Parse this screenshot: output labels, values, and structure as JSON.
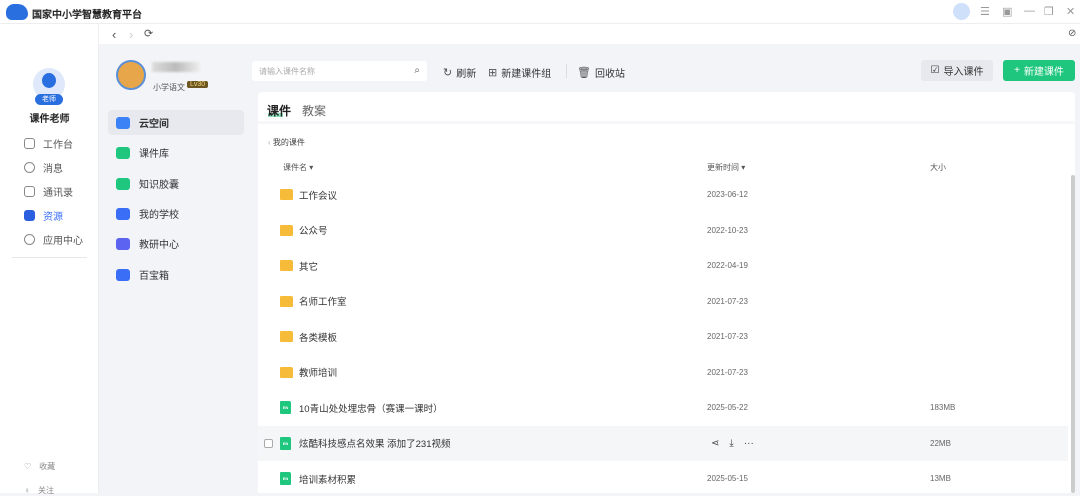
{
  "app": {
    "title": "国家中小学智慧教育平台"
  },
  "window": {
    "icons": [
      "robot-avatar-icon",
      "menu-icon",
      "pip-icon",
      "minimize-icon",
      "restore-icon",
      "close-icon"
    ]
  },
  "nav": {
    "back": "‹",
    "forward": "›",
    "refresh": "⟳",
    "compass": "⊘"
  },
  "user": {
    "badge": "老师",
    "name": "课件老师",
    "subject": "小学语文",
    "level": "Lv30"
  },
  "leftnav": {
    "items": [
      {
        "label": "工作台"
      },
      {
        "label": "消息"
      },
      {
        "label": "通讯录"
      },
      {
        "label": "资源"
      },
      {
        "label": "应用中心"
      }
    ],
    "bottom": [
      {
        "label": "收藏"
      },
      {
        "label": "关注"
      }
    ]
  },
  "menu": {
    "items": [
      {
        "label": "云空间",
        "color": "#3b82f6"
      },
      {
        "label": "课件库",
        "color": "#1fc77e"
      },
      {
        "label": "知识胶囊",
        "color": "#1fc77e"
      },
      {
        "label": "我的学校",
        "color": "#3b6ef6"
      },
      {
        "label": "教研中心",
        "color": "#5b63f0"
      },
      {
        "label": "百宝箱",
        "color": "#3b6ef6"
      }
    ]
  },
  "toolbar": {
    "search_placeholder": "请输入课件名称",
    "refresh": "刷新",
    "new_group": "新建课件组",
    "recycle": "回收站",
    "import": "导入课件",
    "new": "新建课件"
  },
  "tabs": [
    {
      "label": "课件"
    },
    {
      "label": "教案"
    }
  ],
  "breadcrumb": "我的课件",
  "table": {
    "headers": {
      "name": "课件名 ▾",
      "date": "更新时间 ▾",
      "size": "大小"
    },
    "rows": [
      {
        "name": "工作会议",
        "date": "2023-06-12",
        "size": "",
        "type": "folder"
      },
      {
        "name": "公众号",
        "date": "2022-10-23",
        "size": "",
        "type": "folder"
      },
      {
        "name": "其它",
        "date": "2022-04-19",
        "size": "",
        "type": "folder"
      },
      {
        "name": "名师工作室",
        "date": "2021-07-23",
        "size": "",
        "type": "folder"
      },
      {
        "name": "各类模板",
        "date": "2021-07-23",
        "size": "",
        "type": "folder"
      },
      {
        "name": "教师培训",
        "date": "2021-07-23",
        "size": "",
        "type": "folder"
      },
      {
        "name": "10青山处处埋忠骨（赛课一课时）",
        "date": "2025-05-22",
        "size": "183MB",
        "type": "file"
      },
      {
        "name": "炫酷科技感点名效果 添加了231视频",
        "date": "",
        "size": "22MB",
        "type": "file",
        "hover": true
      },
      {
        "name": "培训素材积累",
        "date": "2025-05-15",
        "size": "13MB",
        "type": "file"
      }
    ],
    "file_badge": "EN"
  }
}
